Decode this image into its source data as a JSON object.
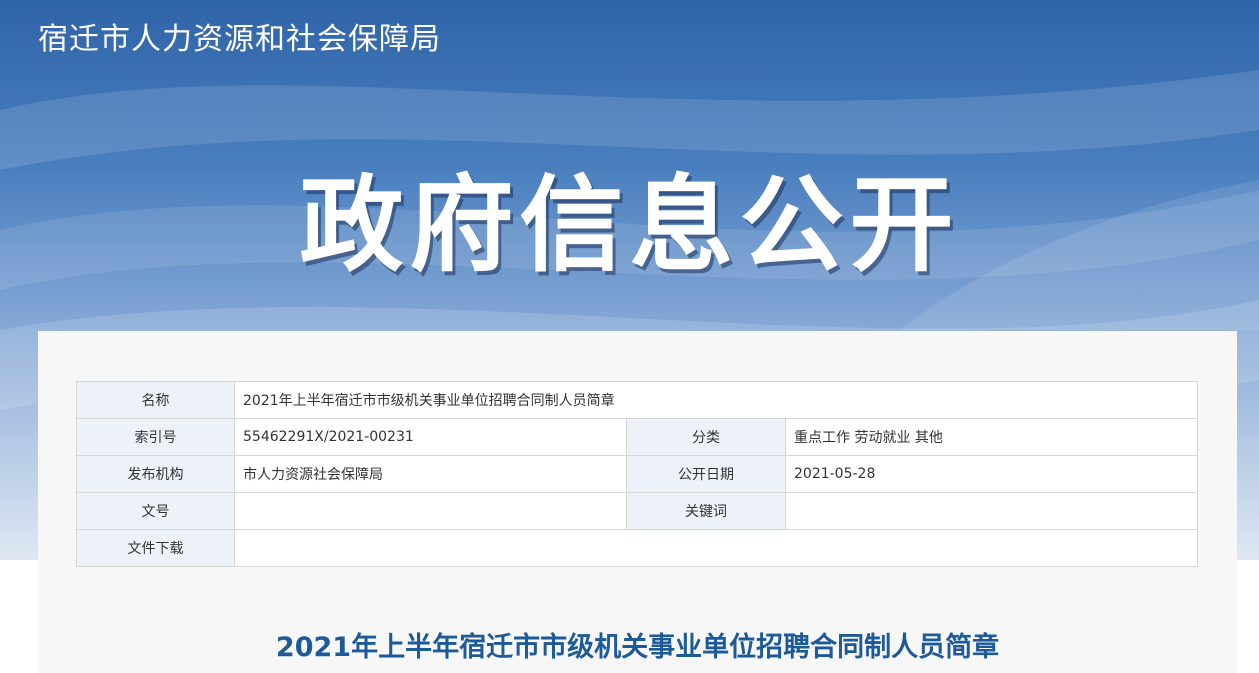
{
  "header": {
    "site_title": "宿迁市人力资源和社会保障局",
    "banner_heading": "政府信息公开"
  },
  "info_table": {
    "name_label": "名称",
    "name_value": "2021年上半年宿迁市市级机关事业单位招聘合同制人员简章",
    "index_label": "索引号",
    "index_value": "55462291X/2021-00231",
    "category_label": "分类",
    "category_value": "重点工作 劳动就业 其他",
    "publisher_label": "发布机构",
    "publisher_value": "市人力资源社会保障局",
    "date_label": "公开日期",
    "date_value": "2021-05-28",
    "doc_no_label": "文号",
    "doc_no_value": "",
    "keywords_label": "关键词",
    "keywords_value": "",
    "download_label": "文件下载",
    "download_value": ""
  },
  "article": {
    "title": "2021年上半年宿迁市市级机关事业单位招聘合同制人员简章"
  }
}
